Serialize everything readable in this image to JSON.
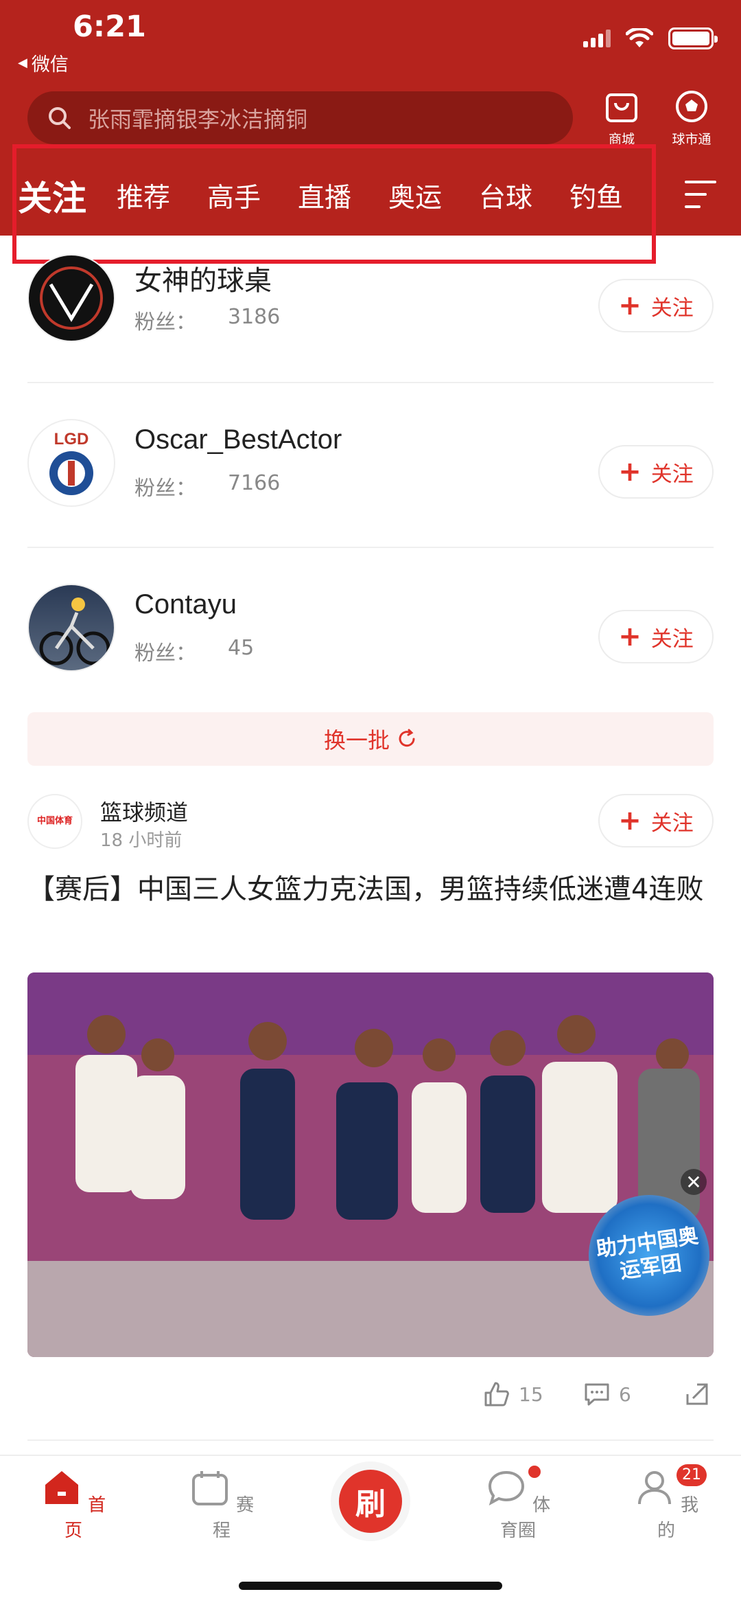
{
  "status": {
    "time": "6:21",
    "back_app": "微信"
  },
  "search": {
    "placeholder": "张雨霏摘银李冰洁摘铜"
  },
  "header_buttons": {
    "shop": "商城",
    "coins": "球市通"
  },
  "tabs": [
    "关注",
    "推荐",
    "高手",
    "直播",
    "奥运",
    "台球",
    "钓鱼"
  ],
  "users": [
    {
      "name": "女神的球桌",
      "fans_label": "粉丝：",
      "fans": "3186",
      "follow": "关注"
    },
    {
      "name": "Oscar_BestActor",
      "fans_label": "粉丝：",
      "fans": "7166",
      "follow": "关注"
    },
    {
      "name": "Contayu",
      "fans_label": "粉丝：",
      "fans": "45",
      "follow": "关注"
    }
  ],
  "refresh": {
    "label": "换一批"
  },
  "post": {
    "channel": "篮球频道",
    "avatar_text": "中国体育",
    "time": "18 小时前",
    "follow": "关注",
    "title": "【赛后】中国三人女篮力克法国，男篮持续低迷遭4连败",
    "image_badge": "助力中国奥运军团",
    "likes": "15",
    "comments": "6"
  },
  "nav": {
    "home": "首页",
    "schedule": "赛程",
    "center": "刷",
    "circle": "体育圈",
    "mine": "我的",
    "mine_badge": "21"
  },
  "colors": {
    "header": "#b5231d",
    "accent": "#e0342b"
  }
}
